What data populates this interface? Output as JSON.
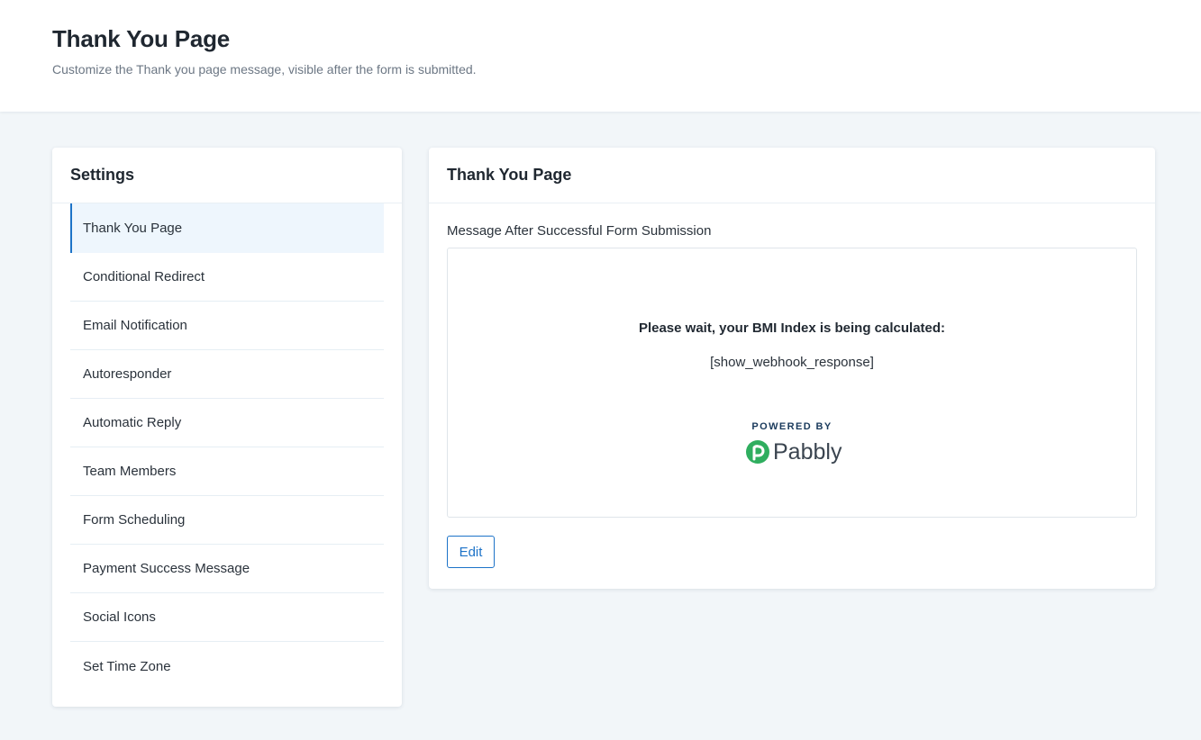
{
  "header": {
    "title": "Thank You Page",
    "subtitle": "Customize the Thank you page message, visible after the form is submitted."
  },
  "settings": {
    "title": "Settings",
    "items": [
      {
        "label": "Thank You Page",
        "active": true
      },
      {
        "label": "Conditional Redirect"
      },
      {
        "label": "Email Notification"
      },
      {
        "label": "Autoresponder"
      },
      {
        "label": "Automatic Reply"
      },
      {
        "label": "Team Members"
      },
      {
        "label": "Form Scheduling"
      },
      {
        "label": "Payment Success Message"
      },
      {
        "label": "Social Icons"
      },
      {
        "label": "Set Time Zone"
      }
    ]
  },
  "content": {
    "title": "Thank You Page",
    "field_label": "Message After Successful Form Submission",
    "preview": {
      "heading": "Please wait, your BMI Index is being calculated:",
      "shortcode": "[show_webhook_response]",
      "powered_by": "POWERED BY",
      "brand_name": "Pabbly"
    },
    "edit_label": "Edit"
  },
  "colors": {
    "accent": "#1d73c8",
    "brand_green": "#2fae5f",
    "background": "#f2f6f9",
    "active_item_bg": "#eef6fd"
  },
  "icons": {
    "brand_logo": "pabbly-logo-icon"
  }
}
